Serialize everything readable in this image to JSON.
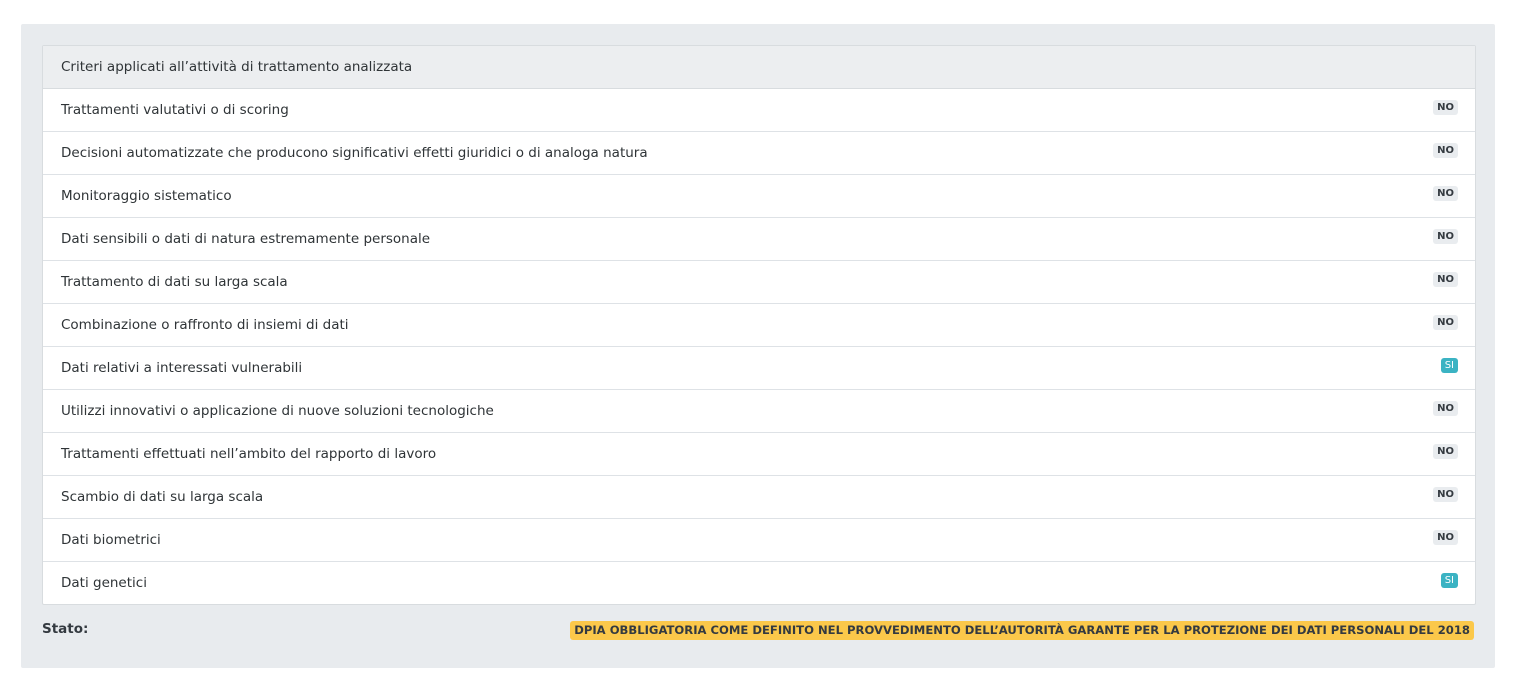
{
  "panel": {
    "header": "Criteri applicati all’attività di trattamento analizzata",
    "rows": [
      {
        "label": "Trattamenti valutativi o di scoring",
        "value": "NO"
      },
      {
        "label": "Decisioni automatizzate che producono significativi effetti giuridici o di analoga natura",
        "value": "NO"
      },
      {
        "label": "Monitoraggio sistematico",
        "value": "NO"
      },
      {
        "label": "Dati sensibili o dati di natura estremamente personale",
        "value": "NO"
      },
      {
        "label": "Trattamento di dati su larga scala",
        "value": "NO"
      },
      {
        "label": "Combinazione o raffronto di insiemi di dati",
        "value": "NO"
      },
      {
        "label": "Dati relativi a interessati vulnerabili",
        "value": "SI"
      },
      {
        "label": "Utilizzi innovativi o applicazione di nuove soluzioni tecnologiche",
        "value": "NO"
      },
      {
        "label": "Trattamenti effettuati nell’ambito del rapporto di lavoro",
        "value": "NO"
      },
      {
        "label": "Scambio di dati su larga scala",
        "value": "NO"
      },
      {
        "label": "Dati biometrici",
        "value": "NO"
      },
      {
        "label": "Dati genetici",
        "value": "SI"
      }
    ]
  },
  "status": {
    "label": "Stato:",
    "value": "DPIA OBBLIGATORIA COME DEFINITO NEL PROVVEDIMENTO DELL’AUTORITÀ GARANTE PER LA PROTEZIONE DEI DATI PERSONALI DEL 2018"
  },
  "colors": {
    "badge_no_bg": "#e9ecef",
    "badge_si_bg": "#3bb3c3",
    "status_bg": "#fbc84a",
    "panel_bg": "#e8ebee"
  }
}
